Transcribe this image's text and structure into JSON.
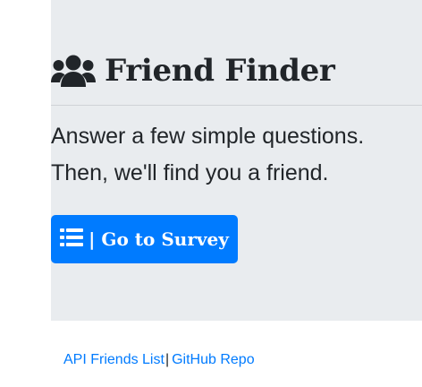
{
  "header": {
    "title": "Friend Finder",
    "icon": "users-icon"
  },
  "lead": {
    "line1": "Answer a few simple questions.",
    "line2": "Then, we'll find you a friend."
  },
  "survey_button": {
    "icon": "list-icon",
    "label": "| Go to Survey",
    "color": "#007bff"
  },
  "footer": {
    "api_link": "API Friends List",
    "separator": "|",
    "github_link": "GitHub Repo"
  },
  "colors": {
    "jumbotron_bg": "#e9ecef",
    "text": "#212529",
    "link": "#007bff"
  }
}
